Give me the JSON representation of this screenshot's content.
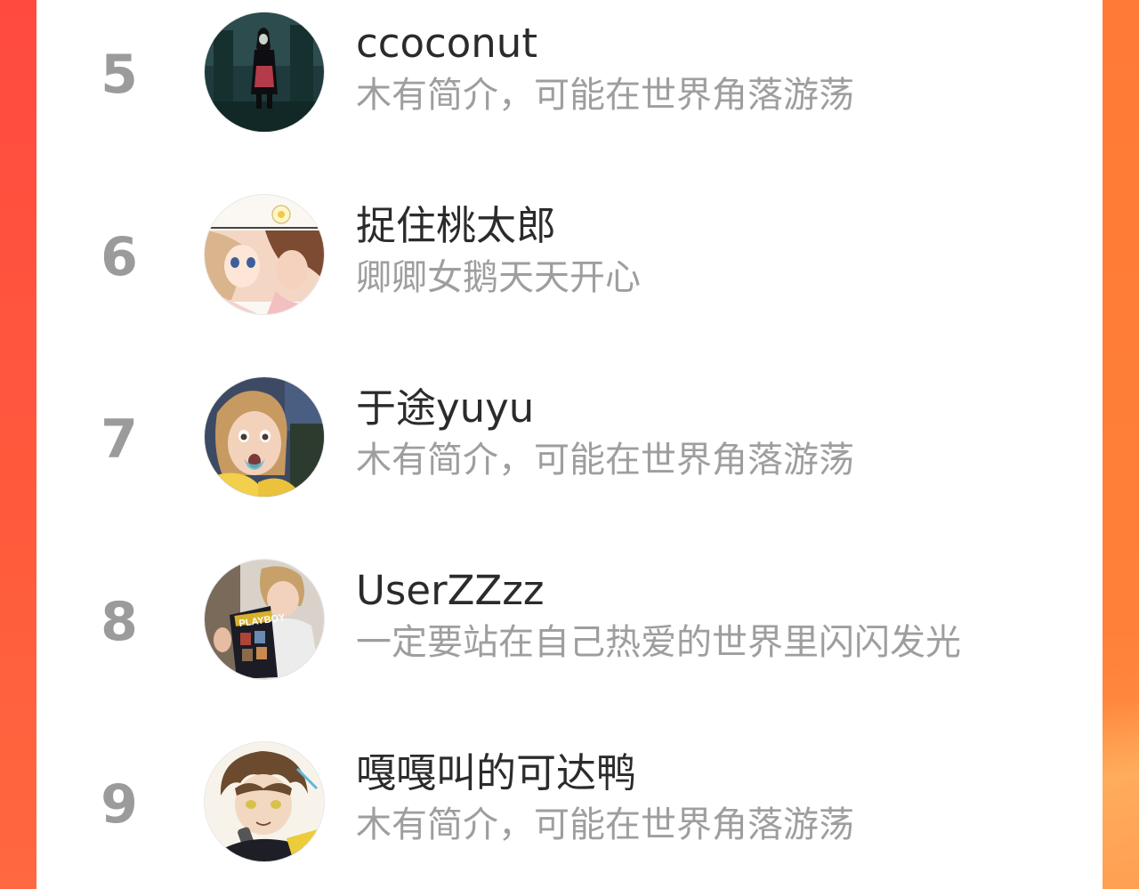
{
  "leaderboard": {
    "rows": [
      {
        "rank": "5",
        "name": "ccoconut",
        "bio": "木有简介，可能在世界角落游荡",
        "avatar": "avatar-dark-scene"
      },
      {
        "rank": "6",
        "name": "捉住桃太郎",
        "bio": "卿卿女鹅天天开心",
        "avatar": "avatar-anime-couple"
      },
      {
        "rank": "7",
        "name": "于途yuyu",
        "bio": "木有简介，可能在世界角落游荡",
        "avatar": "avatar-surprised-child"
      },
      {
        "rank": "8",
        "name": "UserZZzz",
        "bio": "一定要站在自己热爱的世界里闪闪发光",
        "avatar": "avatar-boy-reading-magazine"
      },
      {
        "rank": "9",
        "name": "嘎嘎叫的可达鸭",
        "bio": "木有简介，可能在世界角落游荡",
        "avatar": "avatar-anime-boy"
      }
    ]
  },
  "avatar_5": {
    "magazine_title": "PLAYBOY"
  },
  "colors": {
    "frame_left": "#ff4a40",
    "frame_right": "#ff7a36",
    "card_background": "#ffffff",
    "rank_number": "#9b9b9b",
    "user_name": "#2b2b2b",
    "user_bio": "#9e9e9e"
  }
}
